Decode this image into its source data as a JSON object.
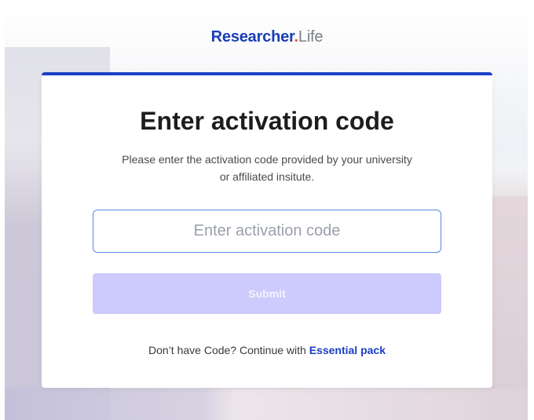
{
  "header": {
    "logo_brand": "Researcher",
    "logo_dot": ".",
    "logo_suffix": "Life"
  },
  "card": {
    "title": "Enter activation code",
    "subtitle": "Please enter the activation code provided by your university or affiliated insitute.",
    "input": {
      "placeholder": "Enter activation code",
      "value": ""
    },
    "submit_label": "Submit",
    "footer_prefix": "Don’t have Code? Continue with",
    "footer_link": "Essential pack"
  },
  "colors": {
    "accent": "#1c3fc4",
    "logo_dot": "#e8572d",
    "submit_disabled_bg": "#cdcbfb"
  }
}
